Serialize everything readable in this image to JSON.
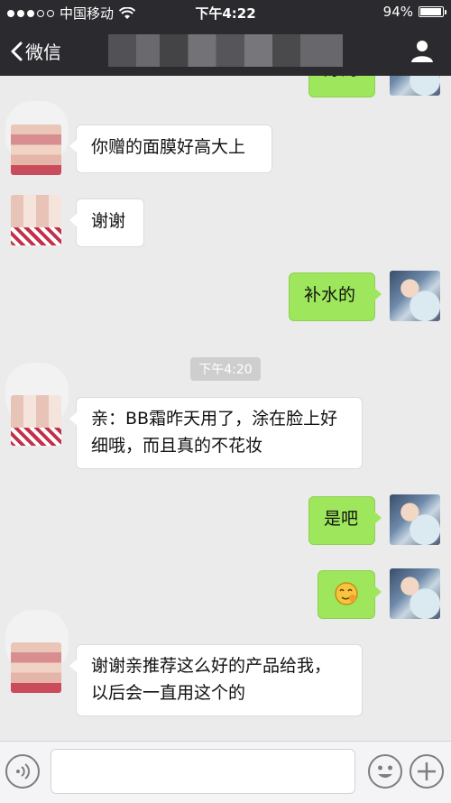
{
  "status_bar": {
    "carrier": "中国移动",
    "time": "下午4:22",
    "battery": "94%",
    "battery_level": 0.94
  },
  "nav": {
    "back_label": "微信",
    "title": "",
    "back_icon": "chevron-left-icon",
    "profile_icon": "user-icon"
  },
  "messages": [
    {
      "side": "out",
      "text": "好的"
    },
    {
      "side": "in",
      "text": "你赠的面膜好高大上"
    },
    {
      "side": "in",
      "text": "谢谢"
    },
    {
      "side": "out",
      "text": "补水的"
    },
    {
      "side": "in",
      "text": "亲：BB霜昨天用了，涂在脸上好细哦，而且真的不花妆"
    },
    {
      "side": "out",
      "text": "是吧"
    },
    {
      "side": "out",
      "text": "[emoji]"
    },
    {
      "side": "in",
      "text": "谢谢亲推荐这么好的产品给我，以后会一直用这个的"
    }
  ],
  "timestamp": "下午4:20",
  "colors": {
    "bar": "#2b2b2f",
    "chat_bg": "#ebebeb",
    "outgoing_bubble": "#9ee65b",
    "incoming_bubble": "#ffffff"
  },
  "input_bar": {
    "voice_icon": "voice-icon",
    "emoji_icon": "emoji-icon",
    "plus_icon": "plus-icon",
    "placeholder": ""
  }
}
